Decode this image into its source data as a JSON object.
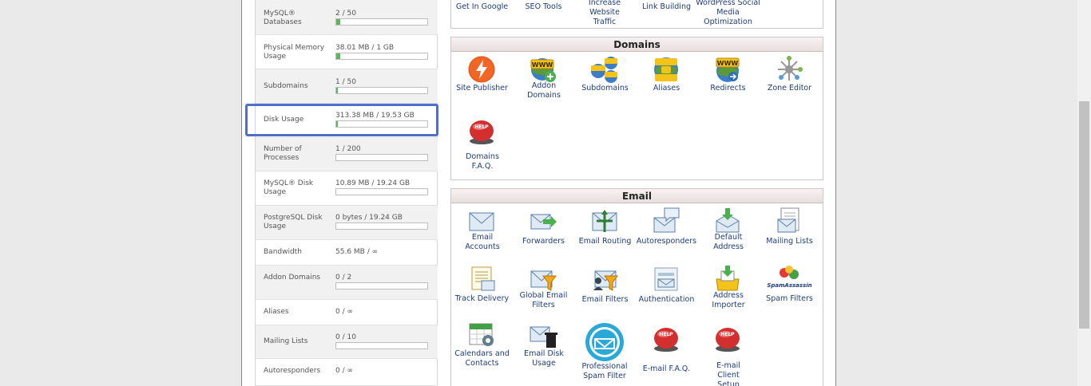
{
  "stats": [
    {
      "label": "MySQL® Databases",
      "value": "2 / 50",
      "fill": 0.04
    },
    {
      "label": "Physical Memory Usage",
      "value": "38.01 MB / 1 GB",
      "fill": 0.04
    },
    {
      "label": "Subdomains",
      "value": "1 / 50",
      "fill": 0.02
    },
    {
      "label": "Disk Usage",
      "value": "313.38 MB / 19.53 GB",
      "fill": 0.016
    },
    {
      "label": "Number of Processes",
      "value": "1 / 200",
      "fill": 0.005
    },
    {
      "label": "MySQL® Disk Usage",
      "value": "10.89 MB / 19.24 GB",
      "fill": 0.001
    },
    {
      "label": "PostgreSQL Disk Usage",
      "value": "0 bytes / 19.24 GB",
      "fill": 0
    },
    {
      "label": "Bandwidth",
      "value": "55.6 MB / ∞"
    },
    {
      "label": "Addon Domains",
      "value": "0 / 2",
      "fill": 0
    },
    {
      "label": "Aliases",
      "value": "0 / ∞"
    },
    {
      "label": "Mailing Lists",
      "value": "0 / 10",
      "fill": 0
    },
    {
      "label": "Autoresponders",
      "value": "0 / ∞"
    }
  ],
  "marketing": {
    "items": [
      "Get In Google",
      "SEO Tools",
      "Increase Website Traffic",
      "Link Building",
      "WordPress Social Media Optimization"
    ]
  },
  "domains": {
    "title": "Domains",
    "items": [
      "Site Publisher",
      "Addon Domains",
      "Subdomains",
      "Aliases",
      "Redirects",
      "Zone Editor",
      "Domains F.A.Q."
    ]
  },
  "email": {
    "title": "Email",
    "items": [
      "Email Accounts",
      "Forwarders",
      "Email Routing",
      "Autoresponders",
      "Default Address",
      "Mailing Lists",
      "Track Delivery",
      "Global Email Filters",
      "Email Filters",
      "Authentication",
      "Address Importer",
      "Spam Filters",
      "Calendars and Contacts",
      "Email Disk Usage",
      "Professional Spam Filter",
      "E-mail F.A.Q.",
      "E-mail Client Setup"
    ],
    "spamassassin_text": "SpamAssassin"
  },
  "icons": [
    "lightning-icon",
    "addon-domain-icon",
    "subdomains-icon",
    "aliases-icon",
    "redirects-icon",
    "zone-editor-icon",
    "help-icon",
    "envelope-icon",
    "forward-icon",
    "routing-icon",
    "autoresponder-icon",
    "default-address-icon",
    "mailing-list-icon",
    "track-delivery-icon",
    "filter-icon",
    "shield-icon",
    "contacts-icon",
    "spamassassin-icon",
    "calendar-icon",
    "trash-icon",
    "spam-filter-icon"
  ]
}
